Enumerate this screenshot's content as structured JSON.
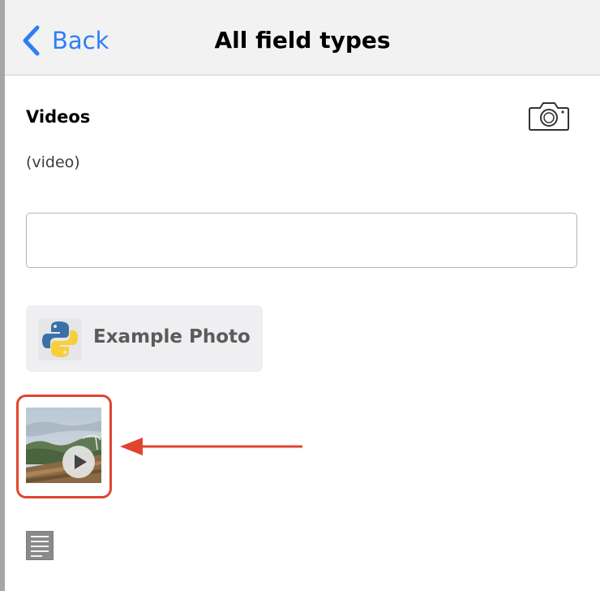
{
  "nav": {
    "back_label": "Back",
    "title": "All field types"
  },
  "field": {
    "label": "Videos",
    "hint": "(video)",
    "input_value": ""
  },
  "example_button": {
    "label": "Example Photo"
  },
  "icons": {
    "back": "chevron-left-icon",
    "camera": "camera-icon",
    "example": "python-logo-icon",
    "play": "play-icon",
    "document": "document-icon",
    "annotation": "arrow-left-icon"
  },
  "colors": {
    "accent": "#2f7df6",
    "highlight": "#e0452f",
    "nav_background": "#f2f2f2",
    "button_background": "#efeff2"
  }
}
